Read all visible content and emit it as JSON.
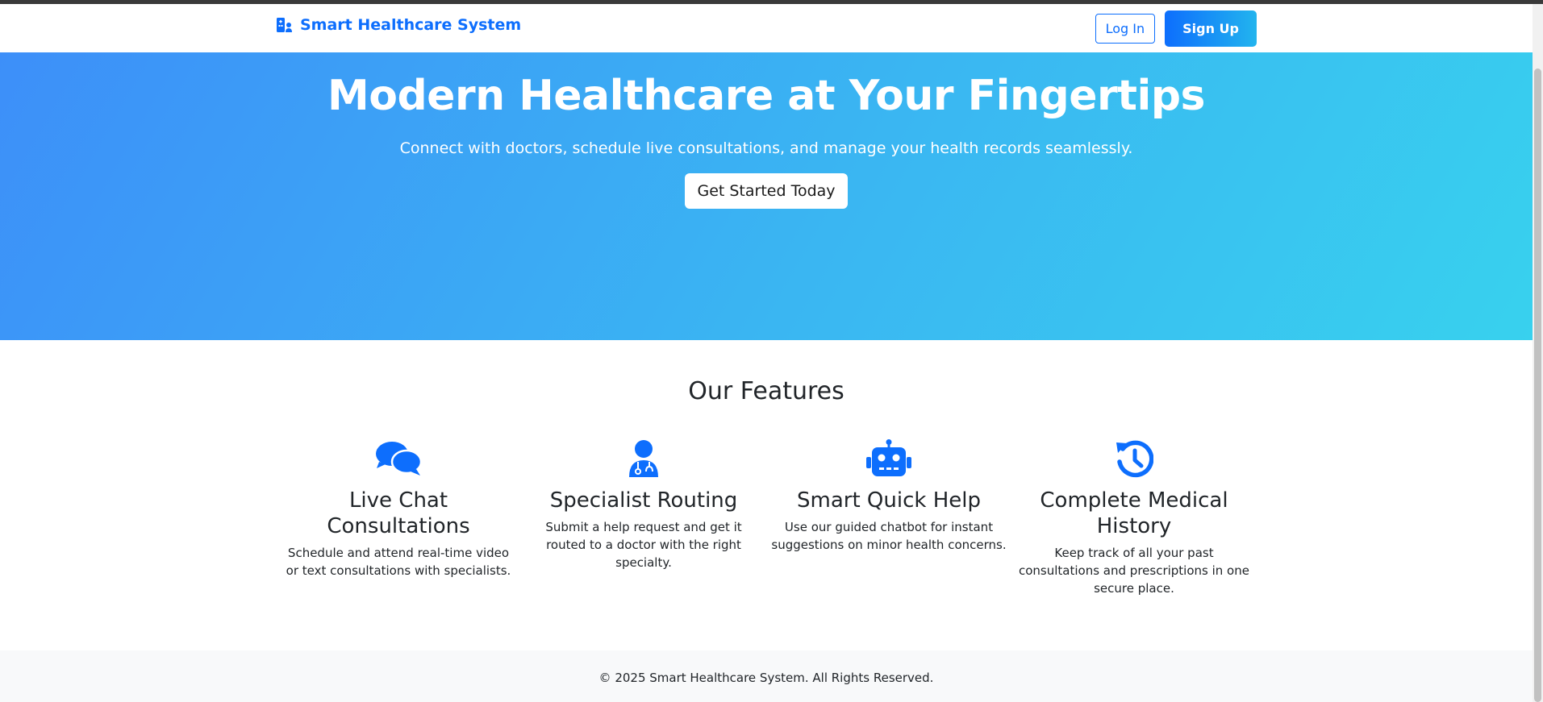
{
  "navbar": {
    "brand": "Smart Healthcare System",
    "login_label": "Log In",
    "signup_label": "Sign Up"
  },
  "hero": {
    "title": "Modern Healthcare at Your Fingertips",
    "subtitle": "Connect with doctors, schedule live consultations, and manage your health records seamlessly.",
    "cta_label": "Get Started Today"
  },
  "features": {
    "heading": "Our Features",
    "items": [
      {
        "icon": "comments-icon",
        "title": "Live Chat Consultations",
        "text": "Schedule and attend real-time video or text consultations with specialists."
      },
      {
        "icon": "doctor-icon",
        "title": "Specialist Routing",
        "text": "Submit a help request and get it routed to a doctor with the right specialty."
      },
      {
        "icon": "robot-icon",
        "title": "Smart Quick Help",
        "text": "Use our guided chatbot for instant suggestions on minor health concerns."
      },
      {
        "icon": "history-icon",
        "title": "Complete Medical History",
        "text": "Keep track of all your past consultations and prescriptions in one secure place."
      }
    ]
  },
  "footer": {
    "copyright": "© 2025 Smart Healthcare System. All Rights Reserved."
  },
  "colors": {
    "primary": "#0d6efd",
    "hero_gradient_start": "#3d8ff9",
    "hero_gradient_end": "#38d1ee",
    "footer_bg": "#f8f9fa"
  }
}
